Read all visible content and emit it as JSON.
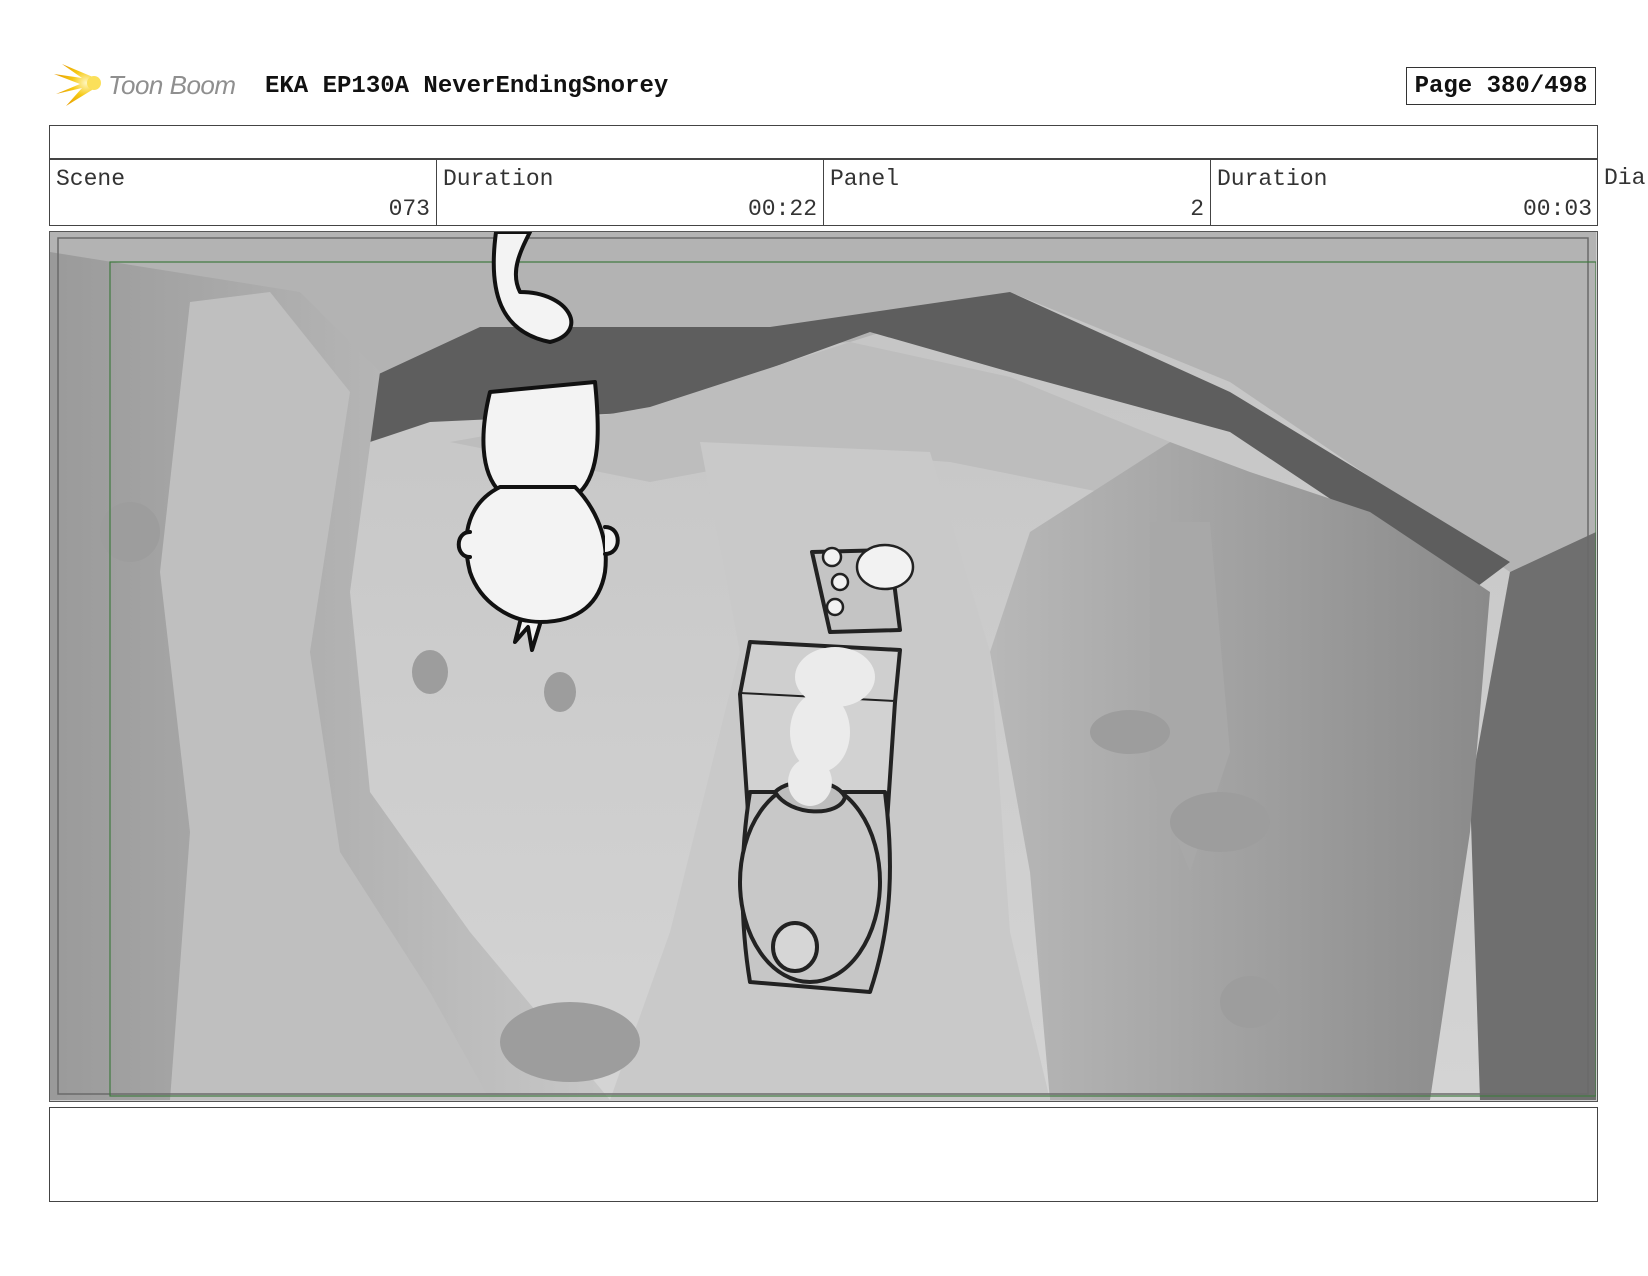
{
  "header": {
    "logo_text": "Toon Boom",
    "title": "EKA EP130A NeverEndingSnorey",
    "page": "Page 380/498"
  },
  "info": {
    "scene_label": "Scene",
    "scene_value": "073",
    "scene_duration_label": "Duration",
    "scene_duration_value": "00:22",
    "panel_label": "Panel",
    "panel_value": "2",
    "panel_duration_label": "Duration",
    "panel_duration_value": "00:03",
    "overflow_label": "Dia"
  },
  "panel_image": {
    "icon": "storyboard-frame-cave-train-icon"
  },
  "colors": {
    "logo_accent": "#f2b705",
    "frame_guide": "#3f7a3f"
  }
}
